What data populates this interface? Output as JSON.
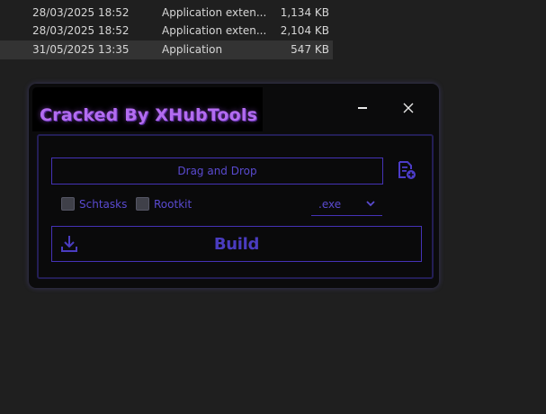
{
  "explorer": {
    "rows": [
      {
        "date": "28/03/2025 18:52",
        "type": "Application exten...",
        "size": "1,134 KB"
      },
      {
        "date": "28/03/2025 18:52",
        "type": "Application exten...",
        "size": "2,104 KB"
      },
      {
        "date": "31/05/2025 13:35",
        "type": "Application",
        "size": "547 KB"
      }
    ]
  },
  "app": {
    "title": "Cracked By XHubTools",
    "drop_label": "Drag and Drop",
    "options": [
      {
        "label": "Schtasks",
        "checked": false
      },
      {
        "label": "Rootkit",
        "checked": false
      }
    ],
    "extension": ".exe",
    "build_label": "Build",
    "accent_color": "#4532b6",
    "title_color": "#b36cf0"
  },
  "icons": [
    "minimize-icon",
    "close-icon",
    "file-add-icon",
    "chevron-down-icon",
    "download-icon"
  ]
}
